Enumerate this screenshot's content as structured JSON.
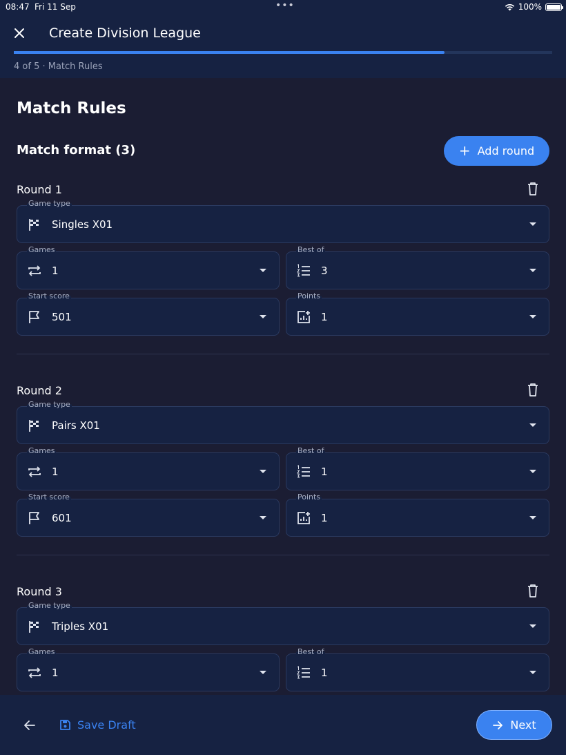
{
  "status": {
    "time": "08:47",
    "date": "Fri 11 Sep",
    "dots": "•••",
    "battery": "100%"
  },
  "header": {
    "title": "Create Division League",
    "step": "4 of 5 · Match Rules",
    "progress": 0.8
  },
  "main": {
    "title": "Match Rules",
    "format_title": "Match format (3)",
    "add_round_label": "Add round",
    "rounds": [
      {
        "title": "Round 1",
        "game_type": {
          "label": "Game type",
          "value": "Singles X01"
        },
        "games": {
          "label": "Games",
          "value": "1"
        },
        "best_of": {
          "label": "Best of",
          "value": "3"
        },
        "start_score": {
          "label": "Start score",
          "value": "501"
        },
        "points": {
          "label": "Points",
          "value": "1"
        }
      },
      {
        "title": "Round 2",
        "game_type": {
          "label": "Game type",
          "value": "Pairs X01"
        },
        "games": {
          "label": "Games",
          "value": "1"
        },
        "best_of": {
          "label": "Best of",
          "value": "1"
        },
        "start_score": {
          "label": "Start score",
          "value": "601"
        },
        "points": {
          "label": "Points",
          "value": "1"
        }
      },
      {
        "title": "Round 3",
        "game_type": {
          "label": "Game type",
          "value": "Triples X01"
        },
        "games": {
          "label": "Games",
          "value": "1"
        },
        "best_of": {
          "label": "Best of",
          "value": "1"
        }
      }
    ]
  },
  "footer": {
    "save_draft_label": "Save Draft",
    "next_label": "Next"
  },
  "colors": {
    "accent": "#3a82f0",
    "background": "#1b1d33",
    "surface": "#162242"
  }
}
